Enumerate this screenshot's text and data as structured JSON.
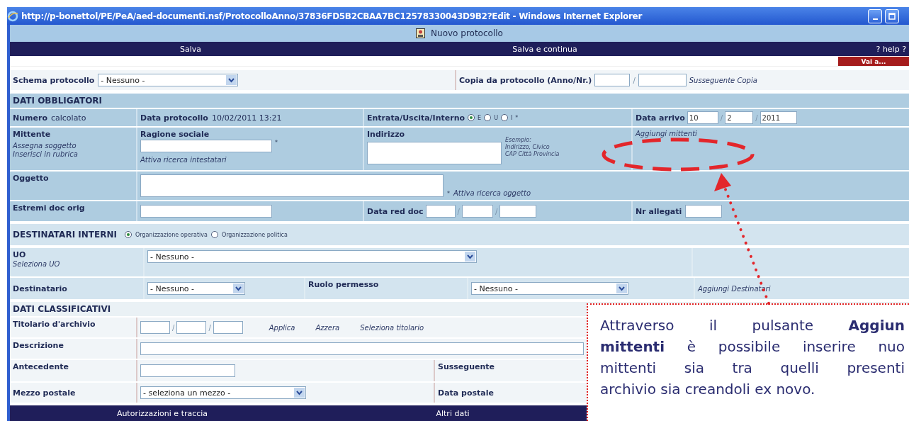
{
  "window": {
    "title": "http://p-bonettol/PE/PeA/aed-documenti.nsf/ProtocolloAnno/37836FD5B2CBAA7BC12578330043D9B2?Edit - Windows Internet Explorer"
  },
  "form_title": "Nuovo protocollo",
  "top_actions": [
    "Salva",
    "Salva e continua"
  ],
  "help": "? help ?",
  "goto_button": "Vai a...",
  "schema": {
    "label": "Schema protocollo",
    "value": "- Nessuno -"
  },
  "copy_from": {
    "label": "Copia da protocollo (Anno/Nr.)",
    "separator": "/",
    "link": "Susseguente Copia"
  },
  "obbligatori": {
    "title": "DATI OBBLIGATORI",
    "numero": {
      "label": "Numero",
      "value": "calcolato"
    },
    "data_protocollo": {
      "label": "Data protocollo",
      "value": "10/02/2011 13:21"
    },
    "direzione": {
      "label": "Entrata/Uscita/Interno",
      "required": "*",
      "options": [
        {
          "label": "E",
          "selected": true
        },
        {
          "label": "U",
          "selected": false
        },
        {
          "label": "I",
          "selected": false
        }
      ]
    },
    "data_arrivo": {
      "label": "Data arrivo",
      "values": [
        "10",
        "2",
        "2011"
      ],
      "separator": "/"
    },
    "mittente": {
      "label": "Mittente",
      "links": [
        "Assegna soggetto",
        "Inserisci in rubrica"
      ]
    },
    "ragione_sociale": {
      "label": "Ragione sociale",
      "required": "*",
      "link": "Attiva ricerca intestatari"
    },
    "indirizzo": {
      "label": "Indirizzo",
      "hint": [
        "Esempio:",
        "Indirizzo, Civico",
        "CAP Città Provincia"
      ]
    },
    "aggiungi_mittenti": "Aggiungi mittenti",
    "oggetto": {
      "label": "Oggetto",
      "required": "*",
      "link": "Attiva ricerca oggetto"
    },
    "estremi": {
      "label": "Estremi doc orig"
    },
    "data_red_doc": {
      "label": "Data red doc",
      "separator": "/"
    },
    "nr_allegati": {
      "label": "Nr allegati"
    }
  },
  "destinatari": {
    "title": "DESTINATARI INTERNI",
    "options": [
      {
        "label": "Organizzazione operativa",
        "selected": true
      },
      {
        "label": "Organizzazione politica",
        "selected": false
      }
    ],
    "uo": {
      "label": "UO",
      "link": "Seleziona UO",
      "value": "- Nessuno -"
    },
    "destinatario": {
      "label": "Destinatario",
      "value": "- Nessuno -"
    },
    "ruolo": {
      "label": "Ruolo permesso",
      "value": "- Nessuno -"
    },
    "aggiungi": "Aggiungi Destinatari"
  },
  "classificativi": {
    "title": "DATI CLASSIFICATIVI",
    "titolario": {
      "label": "Titolario d'archivio",
      "separator": "/",
      "actions": [
        "Applica",
        "Azzera",
        "Seleziona titolario"
      ]
    },
    "descrizione": {
      "label": "Descrizione"
    },
    "antecedente": {
      "label": "Antecedente"
    },
    "susseguente": {
      "label": "Susseguente"
    },
    "mezzo_postale": {
      "label": "Mezzo postale",
      "value": "- seleziona un mezzo -"
    },
    "data_postale": {
      "label": "Data postale"
    }
  },
  "bottom_actions": [
    "Autorizzazioni e traccia",
    "Altri dati"
  ],
  "callout": {
    "lines": [
      "Attraverso il pulsante **Aggiun**",
      "**mittenti** è possibile inserire nuo",
      "mittenti sia tra quelli presenti",
      "archivio sia creandoli ex novo."
    ]
  }
}
